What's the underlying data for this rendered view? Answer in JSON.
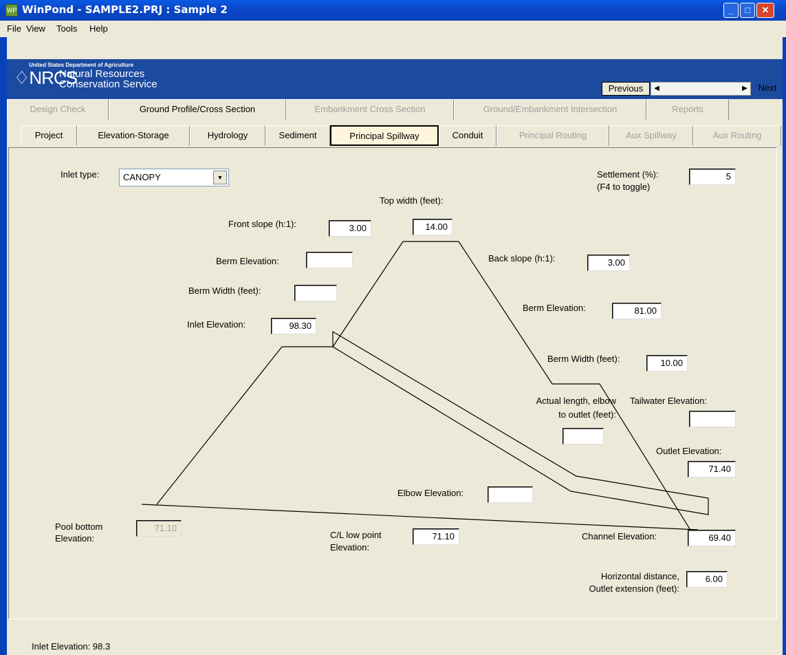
{
  "window": {
    "title": "WinPond - SAMPLE2.PRJ : Sample 2",
    "minimize_glyph": "_",
    "maximize_glyph": "□",
    "close_glyph": "✕"
  },
  "menu": [
    "File",
    "View",
    "Tools",
    "Help"
  ],
  "banner": {
    "agency_small": "United States Department of Agriculture",
    "logo_text": "NRCS",
    "logo_mark": "♢",
    "line1": "Natural Resources",
    "line2": "Conservation Service"
  },
  "nav": {
    "previous": "Previous",
    "next": "Next",
    "left_arrow": "◀",
    "right_arrow": "▶"
  },
  "tabs_row1": [
    "Design Check",
    "Ground Profile/Cross Section",
    "Embankment Cross Section",
    "Ground/Embankment Intersection",
    "Reports"
  ],
  "tabs_row2": [
    "Project",
    "Elevation-Storage",
    "Hydrology",
    "Sediment",
    "Principal Spillway",
    "Conduit",
    "Principal Routing",
    "Aux Spillway",
    "Aux Routing"
  ],
  "form": {
    "inlet_type_label": "Inlet type:",
    "inlet_type_value": "CANOPY",
    "dropdown_glyph": "▼",
    "settlement_label": "Settlement (%):",
    "settlement_hint": "(F4 to toggle)",
    "settlement_value": "5",
    "top_width_label": "Top width (feet):",
    "top_width_value": "14.00",
    "front_slope_label": "Front slope (h:1):",
    "front_slope_value": "3.00",
    "berm_elev_front_label": "Berm Elevation:",
    "berm_elev_front_value": "",
    "berm_width_front_label": "Berm Width (feet):",
    "berm_width_front_value": "",
    "inlet_elev_label": "Inlet Elevation:",
    "inlet_elev_value": "98.30",
    "back_slope_label": "Back slope (h:1):",
    "back_slope_value": "3.00",
    "berm_elev_back_label": "Berm Elevation:",
    "berm_elev_back_value": "81.00",
    "berm_width_back_label": "Berm Width (feet):",
    "berm_width_back_value": "10.00",
    "actual_length_label1": "Actual length, elbow",
    "actual_length_label2": "to outlet (feet):",
    "actual_length_value": "",
    "tailwater_label": "Tailwater Elevation:",
    "tailwater_value": "",
    "outlet_elev_label": "Outlet Elevation:",
    "outlet_elev_value": "71.40",
    "elbow_elev_label": "Elbow Elevation:",
    "elbow_elev_value": "",
    "pool_bottom_label1": "Pool bottom",
    "pool_bottom_label2": "Elevation:",
    "pool_bottom_value": "71.10",
    "cl_low_label1": "C/L low point",
    "cl_low_label2": "Elevation:",
    "cl_low_value": "71.10",
    "channel_elev_label": "Channel Elevation:",
    "channel_elev_value": "69.40",
    "horiz_label1": "Horizontal distance,",
    "horiz_label2": "Outlet extension (feet):",
    "horiz_value": "6.00"
  },
  "status": "Inlet Elevation:  98.3"
}
